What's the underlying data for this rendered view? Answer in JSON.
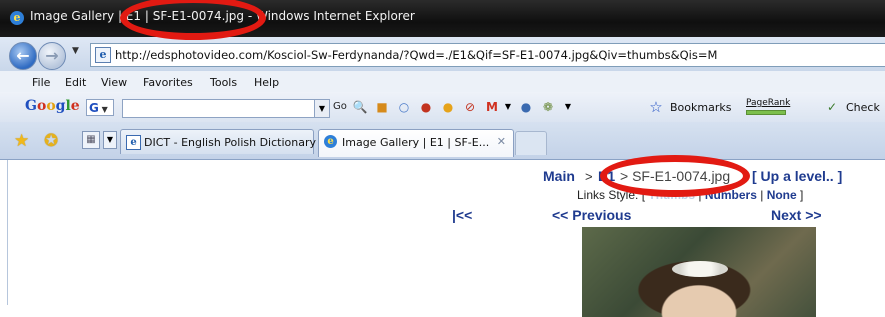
{
  "window": {
    "title": "Image Gallery | E1 | SF-E1-0074.jpg - Windows Internet Explorer"
  },
  "address": {
    "url": "http://edsphotovideo.com/Kosciol-Sw-Ferdynanda/?Qwd=./E1&Qif=SF-E1-0074.jpg&Qiv=thumbs&Qis=M"
  },
  "menu": {
    "items": [
      "File",
      "Edit",
      "View",
      "Favorites",
      "Tools",
      "Help"
    ]
  },
  "google_toolbar": {
    "logo_text": "Google",
    "g_button": "G",
    "go_label": "Go",
    "bookmarks_label": "Bookmarks",
    "pagerank_label": "PageRank",
    "check_label": "Check"
  },
  "tabs": {
    "items": [
      {
        "label": "DICT - English Polish Dictionary",
        "active": false
      },
      {
        "label": "Image Gallery | E1 | SF-E...",
        "active": true
      }
    ]
  },
  "page": {
    "breadcrumb": {
      "main": "Main",
      "separator": ">",
      "folder": "E1",
      "current": "> SF-E1-0074.jpg",
      "up_level": "[ Up a level.. ]"
    },
    "links_style": {
      "prefix": "Links Style: [",
      "thumbs": "Thumbs",
      "sep1": "|",
      "numbers": "Numbers",
      "sep2": "|",
      "none": "None",
      "suffix": "]"
    },
    "nav": {
      "first": "|<<",
      "previous": "<< Previous",
      "next": "Next >>"
    }
  },
  "annotations": {
    "highlight_color": "#e21a12"
  }
}
